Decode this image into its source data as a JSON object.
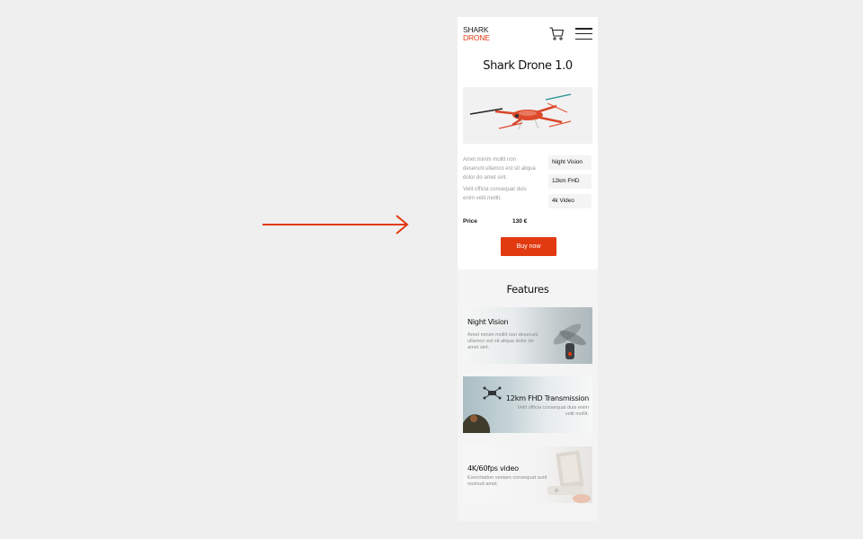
{
  "brand": {
    "line1": "SHARK",
    "line2": "DRONE",
    "accent_color": "#e23a10"
  },
  "header": {
    "cart_icon": "cart-icon",
    "menu_icon": "hamburger-menu-icon"
  },
  "product": {
    "title": "Shark Drone 1.0",
    "description": [
      "Amet minim mollit non deserunt ullamco est sit aliqua dolor do amet sint.",
      "Velit officia consequat duis enim velit mollit."
    ],
    "specs": [
      "Night Vision",
      "12km FHD",
      "4k Video"
    ],
    "price_label": "Price",
    "price_value": "130 €",
    "buy_label": "Buy now"
  },
  "features": {
    "title": "Features",
    "cards": [
      {
        "title": "Night Vision",
        "text": "Amet minim mollit non deserunt ullamco est sit aliqua dolor do amet sint."
      },
      {
        "title": "12km FHD Transmission",
        "text": "Velit officia consequat duis enim velit mollit."
      },
      {
        "title": "4K/60fps video",
        "text": "Exercitation veniam consequat sunt nostrud amet."
      }
    ]
  }
}
